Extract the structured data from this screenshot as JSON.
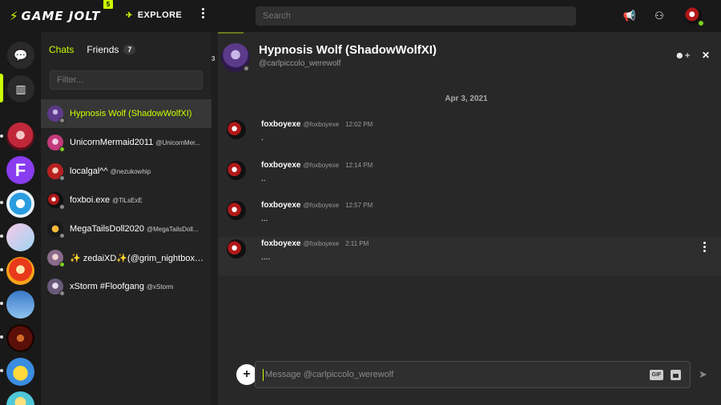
{
  "topbar": {
    "logo_text": "GAME JOLT",
    "logo_badge": "5",
    "explore_label": "EXPLORE",
    "search_placeholder": "Search",
    "icons": [
      "lightning-icon",
      "kebab-menu-icon",
      "megaphone-icon",
      "friend-requests-icon",
      "user-avatar"
    ]
  },
  "colors": {
    "accent": "#ccff00",
    "online": "#7ecf1d",
    "background": "#191919",
    "panel": "#232323",
    "main": "#282828"
  },
  "rail": {
    "buttons": [
      "chat-icon",
      "library-icon"
    ],
    "communities": [
      "community-1",
      "community-fortnite",
      "community-3",
      "community-4",
      "community-cuphead",
      "community-6",
      "community-fnaf",
      "community-pikachu",
      "community-9"
    ],
    "fortnite_letter": "F"
  },
  "chatlist": {
    "tab_chats": "Chats",
    "tab_friends": "Friends",
    "friends_count": "7",
    "filter_placeholder": "Filter...",
    "items": [
      {
        "name": "Hypnosis Wolf (ShadowWolfXI)",
        "handle": "",
        "status": "offline",
        "active": true
      },
      {
        "name": "UnicornMermaid2011",
        "handle": "@UnicornMer...",
        "status": "online",
        "active": false
      },
      {
        "name": "localgal^^",
        "handle": "@nezukowhip",
        "status": "offline",
        "active": false
      },
      {
        "name": "foxboi.exe",
        "handle": "@TiLsExE",
        "status": "offline",
        "active": false
      },
      {
        "name": "MegaTailsDoll2020",
        "handle": "@MegaTailsDoll...",
        "status": "offline",
        "active": false
      },
      {
        "name": "✨ zedaiXD✨(@grim_nightboxg...",
        "handle": "",
        "status": "online",
        "active": false
      },
      {
        "name": "xStorm #Floofgang",
        "handle": "@xStorm",
        "status": "offline",
        "active": false
      }
    ]
  },
  "main": {
    "mini_count": "3",
    "header_name": "Hypnosis Wolf (ShadowWolfXI)",
    "header_username": "@carlpiccolo_werewolf",
    "date_separator": "Apr 3, 2021",
    "messages": [
      {
        "author": "foxboyexe",
        "handle": "@foxboyexe",
        "time": "12:02 PM",
        "text": "."
      },
      {
        "author": "foxboyexe",
        "handle": "@foxboyexe",
        "time": "12:14 PM",
        "text": ".."
      },
      {
        "author": "foxboyexe",
        "handle": "@foxboyexe",
        "time": "12:57 PM",
        "text": "..."
      },
      {
        "author": "foxboyexe",
        "handle": "@foxboyexe",
        "time": "2:11 PM",
        "text": "...."
      }
    ],
    "composer_placeholder": "Message @carlpiccolo_werewolf",
    "gif_label": "GIF"
  }
}
